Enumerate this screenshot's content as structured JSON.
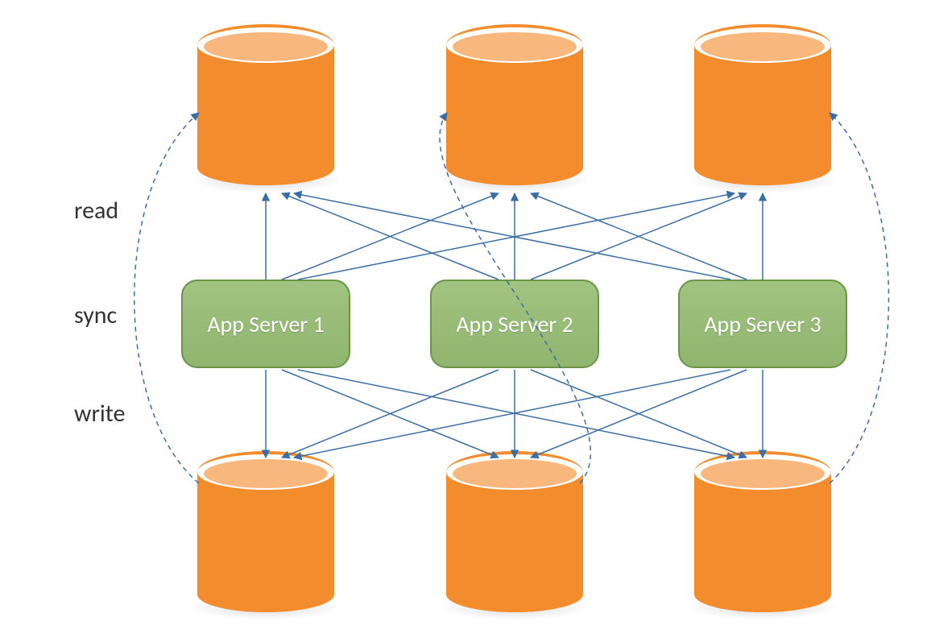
{
  "labels": {
    "read": "read",
    "sync": "sync",
    "write": "write"
  },
  "servers": [
    {
      "label": "App Server 1"
    },
    {
      "label": "App Server 2"
    },
    {
      "label": "App Server 3"
    }
  ],
  "databases": {
    "topCount": 3,
    "bottomCount": 3
  },
  "connections": {
    "read": [
      {
        "from": "server1",
        "to": "topDb1"
      },
      {
        "from": "server1",
        "to": "topDb2"
      },
      {
        "from": "server1",
        "to": "topDb3"
      },
      {
        "from": "server2",
        "to": "topDb1"
      },
      {
        "from": "server2",
        "to": "topDb2"
      },
      {
        "from": "server2",
        "to": "topDb3"
      },
      {
        "from": "server3",
        "to": "topDb1"
      },
      {
        "from": "server3",
        "to": "topDb2"
      },
      {
        "from": "server3",
        "to": "topDb3"
      }
    ],
    "write": [
      {
        "from": "server1",
        "to": "botDb1"
      },
      {
        "from": "server1",
        "to": "botDb2"
      },
      {
        "from": "server1",
        "to": "botDb3"
      },
      {
        "from": "server2",
        "to": "botDb1"
      },
      {
        "from": "server2",
        "to": "botDb2"
      },
      {
        "from": "server2",
        "to": "botDb3"
      },
      {
        "from": "server3",
        "to": "botDb1"
      },
      {
        "from": "server3",
        "to": "botDb2"
      },
      {
        "from": "server3",
        "to": "botDb3"
      }
    ],
    "sync": [
      {
        "from": "botDb1",
        "to": "topDb1"
      },
      {
        "from": "botDb2",
        "to": "topDb2"
      },
      {
        "from": "botDb3",
        "to": "topDb3"
      }
    ]
  },
  "colors": {
    "server": "#8fb56f",
    "serverBorder": "#6a9547",
    "database": "#f28c2c",
    "databaseTop": "#f7b77d",
    "arrow": "#3a6ea5"
  }
}
